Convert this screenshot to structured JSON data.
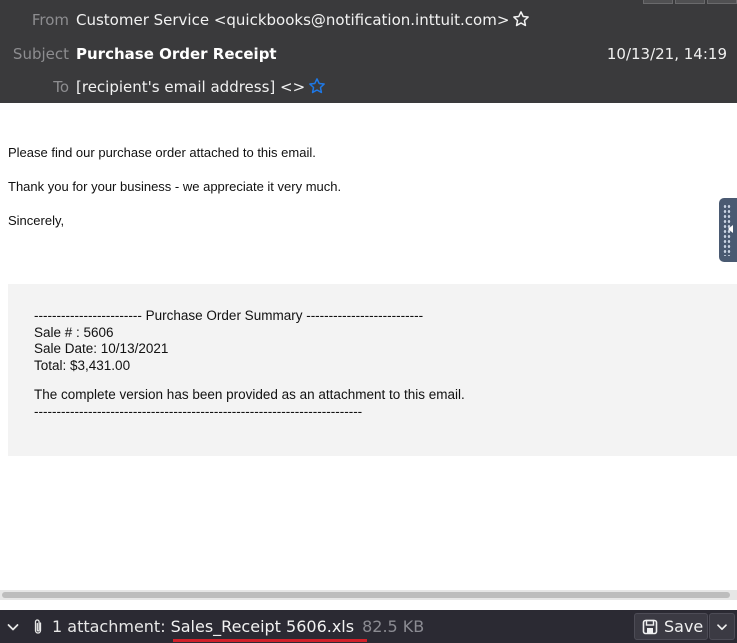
{
  "header": {
    "from_label": "From",
    "from_value": "Customer Service <quickbooks@notification.inttuit.com>",
    "subject_label": "Subject",
    "subject_value": "Purchase Order Receipt",
    "date": "10/13/21, 14:19",
    "to_label": "To",
    "to_value": "[recipient's email address] <>",
    "from_star_icon": "star-outline-icon",
    "to_star_icon": "star-outline-icon",
    "accent_color": "#1e78e6"
  },
  "message": {
    "line1": "Please find our purchase order attached to this email.",
    "line2": "Thank you for your business - we appreciate it very much.",
    "line3": "Sincerely,"
  },
  "summary": {
    "heading": "------------------------  Purchase Order Summary  --------------------------",
    "sale_no": "Sale # : 5606",
    "sale_date": "Sale Date: 10/13/2021",
    "total": "Total: $3,431.00",
    "note": "The complete version has been provided as an attachment to this email.",
    "divider": "-------------------------------------------------------------------------"
  },
  "attachments": {
    "count_label": "1 attachment:",
    "filename": "Sales_Receipt 5606.xls",
    "size": "82.5 KB",
    "save_label": "Save"
  },
  "colors": {
    "header_bg": "#3a3a3c",
    "attachment_bar_bg": "#2b2a33",
    "filename_underline": "#d2202a"
  }
}
